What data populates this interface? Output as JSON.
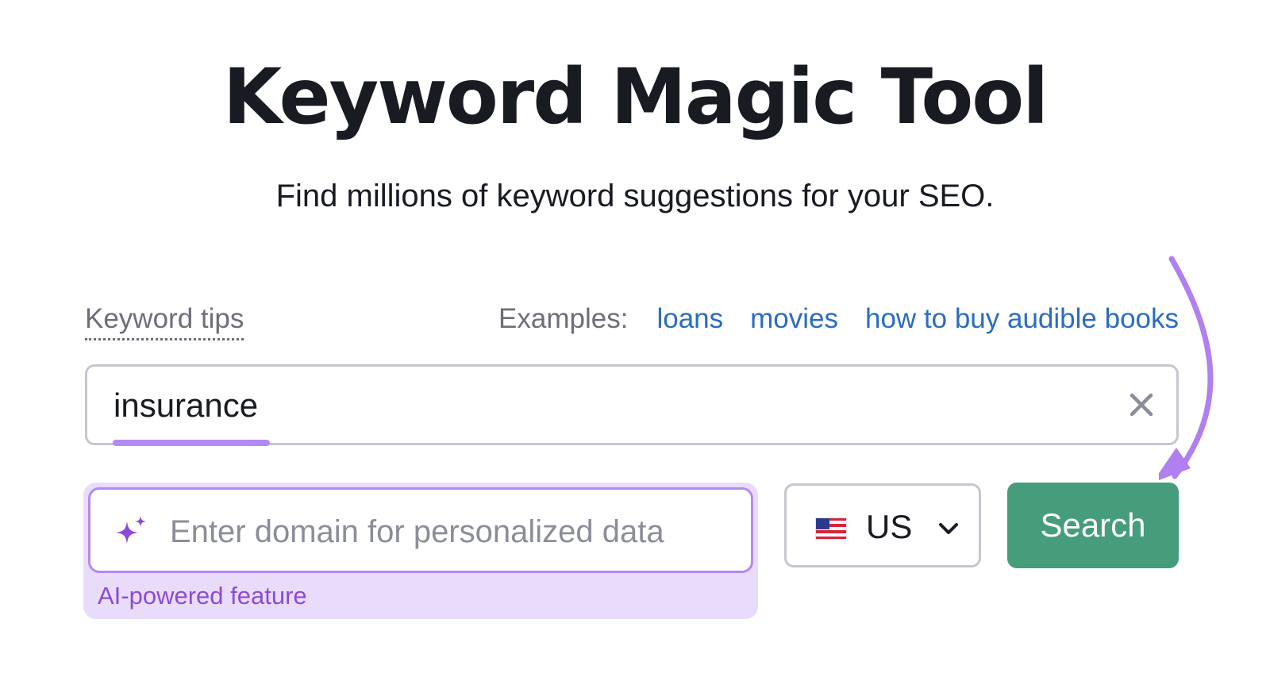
{
  "header": {
    "title": "Keyword Magic Tool",
    "subtitle": "Find millions of keyword suggestions for your SEO."
  },
  "tips": {
    "label": "Keyword tips"
  },
  "examples": {
    "label": "Examples:",
    "items": [
      "loans",
      "movies",
      "how to buy audible books"
    ]
  },
  "search": {
    "value": "insurance"
  },
  "ai_domain": {
    "placeholder": "Enter domain for personalized data",
    "note": "AI-powered feature"
  },
  "country": {
    "code": "US"
  },
  "actions": {
    "search_label": "Search"
  },
  "colors": {
    "accent_purple": "#b38af0",
    "search_button": "#459d7c",
    "link_blue": "#2b6cc4"
  }
}
